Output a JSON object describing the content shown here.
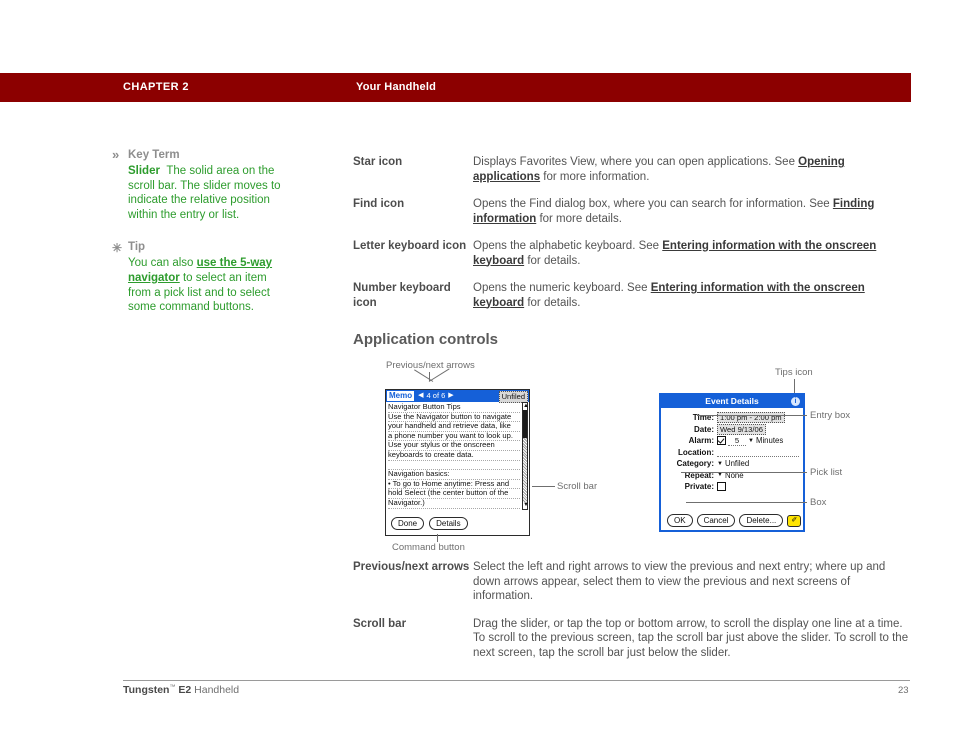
{
  "header": {
    "chapter": "CHAPTER 2",
    "title": "Your Handheld"
  },
  "sidebar": {
    "blocks": [
      {
        "marker": "chevron-double-right",
        "marker_glyph": "»",
        "heading": "Key Term",
        "term": "Slider",
        "text": "The solid area on the scroll bar. The slider moves to indicate the relative position within the entry or list."
      },
      {
        "marker": "asterisk",
        "marker_glyph": "✳",
        "heading": "Tip",
        "text_before": "You can also ",
        "link": "use the 5-way navigator",
        "text_after": " to select an item from a pick list and to select some command buttons."
      }
    ]
  },
  "icon_definitions": [
    {
      "term": "Star icon",
      "desc_1": "Displays Favorites View, where you can open applications. See ",
      "link": "Opening applications",
      "desc_2": " for more information."
    },
    {
      "term": "Find icon",
      "desc_1": "Opens the Find dialog box, where you can search for information. See ",
      "link": "Finding information",
      "desc_2": " for more details."
    },
    {
      "term": "Letter keyboard icon",
      "desc_1": "Opens the alphabetic keyboard. See ",
      "link": "Entering information with the onscreen keyboard",
      "desc_2": " for details."
    },
    {
      "term": "Number keyboard icon",
      "desc_1": "Opens the numeric keyboard. See ",
      "link": "Entering information with the onscreen keyboard",
      "desc_2": " for details."
    }
  ],
  "section": {
    "title": "Application controls"
  },
  "figure": {
    "callouts": {
      "previous_next_arrows": "Previous/next arrows",
      "scroll_bar": "Scroll bar",
      "command_button": "Command button",
      "tips_icon": "Tips icon",
      "entry_box": "Entry box",
      "pick_list": "Pick list",
      "box": "Box"
    },
    "memo_screen": {
      "app_tab": "Memo",
      "prev_arrow": "◀",
      "next_arrow": "▶",
      "record_counter": "4 of 6",
      "category": "Unfiled",
      "lines": [
        "Navigator Button Tips",
        "Use the Navigator button to navigate",
        "your handheld and retrieve data, like",
        "a phone number you want to look up.",
        "Use your stylus or the onscreen",
        "keyboards to create data.",
        "",
        "Navigation basics:",
        "• To go to Home anytime: Press and",
        "hold Select (the center button of the",
        "Navigator.)"
      ],
      "scroll_up_arrow": "▲",
      "scroll_down_arrow": "▼",
      "buttons": [
        "Done",
        "Details"
      ]
    },
    "event_dialog": {
      "title": "Event Details",
      "tips_glyph": "i",
      "rows": [
        {
          "label": "Time:",
          "value": "1:00 pm - 2:00 pm",
          "kind": "entry"
        },
        {
          "label": "Date:",
          "value": "Wed 9/13/06",
          "kind": "entry"
        },
        {
          "label": "Alarm:",
          "value": "5",
          "unit": "Minutes",
          "kind": "alarm",
          "checked": true
        },
        {
          "label": "Location:",
          "value": "",
          "kind": "line"
        },
        {
          "label": "Category:",
          "value": "Unfiled",
          "kind": "pick"
        },
        {
          "label": "Repeat:",
          "value": "None",
          "kind": "pick"
        },
        {
          "label": "Private:",
          "value": "",
          "kind": "checkbox",
          "checked": false
        }
      ],
      "buttons": [
        "OK",
        "Cancel",
        "Delete..."
      ],
      "note_glyph": "✐"
    }
  },
  "control_definitions": [
    {
      "term": "Previous/next arrows",
      "desc": "Select the left and right arrows to view the previous and next entry; where up and down arrows appear, select them to view the previous and next screens of information."
    },
    {
      "term": "Scroll bar",
      "desc": "Drag the slider, or tap the top or bottom arrow, to scroll the display one line at a time. To scroll to the previous screen, tap the scroll bar just above the slider. To scroll to the next screen, tap the scroll bar just below the slider."
    }
  ],
  "footer": {
    "product_bold": "Tungsten",
    "trademark": "™",
    "model_bold": " E2",
    "product_rest": " Handheld",
    "page_number": "23"
  },
  "colors": {
    "header_band": "#8c0000",
    "sidebar_text": "#2d9c2d",
    "sidebar_heading": "#8e8e8e",
    "body_text": "#545454",
    "palm_blue": "#1560d8",
    "note_yellow": "#ffe400"
  }
}
